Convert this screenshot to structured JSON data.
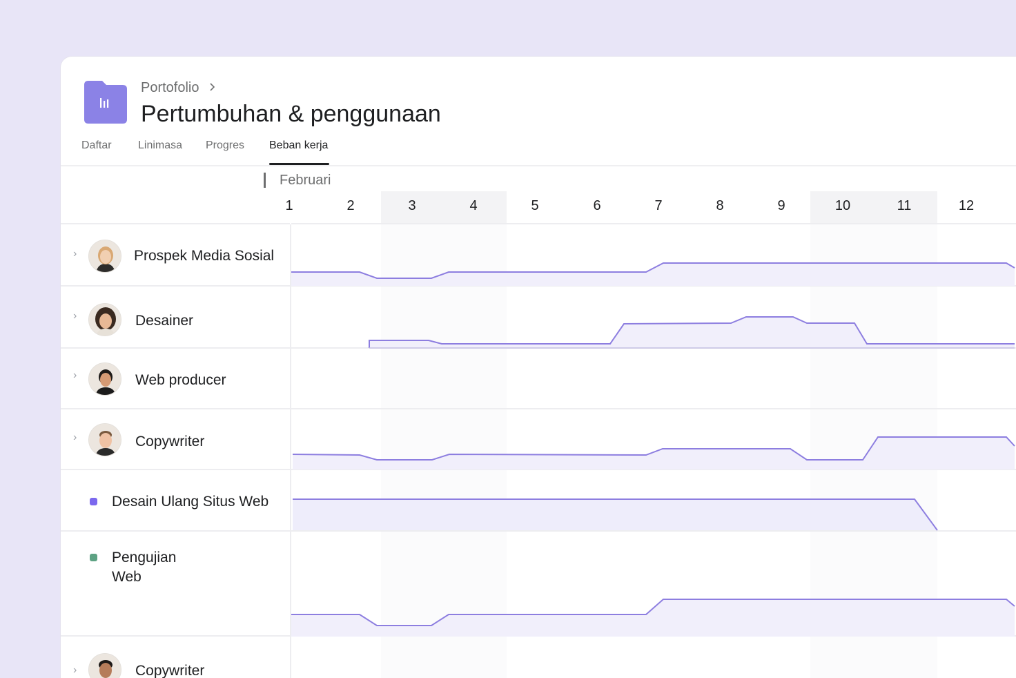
{
  "breadcrumb": {
    "parent": "Portofolio"
  },
  "page": {
    "title": "Pertumbuhan & penggunaan"
  },
  "tabs": [
    {
      "label": "Daftar",
      "active": false
    },
    {
      "label": "Linimasa",
      "active": false
    },
    {
      "label": "Progres",
      "active": false
    },
    {
      "label": "Beban kerja",
      "active": true
    }
  ],
  "calendar": {
    "month": "Februari",
    "days": [
      "1",
      "2",
      "3",
      "4",
      "5",
      "6",
      "7",
      "8",
      "9",
      "10",
      "11",
      "12"
    ]
  },
  "rows": [
    {
      "label": "Prospek Media Sosial",
      "type": "person"
    },
    {
      "label": "Desainer",
      "type": "person"
    },
    {
      "label": "Web producer",
      "type": "person"
    },
    {
      "label": "Copywriter",
      "type": "person"
    },
    {
      "label": "Desain Ulang Situs Web",
      "type": "project",
      "color": "#7b68ee"
    },
    {
      "label_line1": "Pengujian",
      "label_line2": "Web",
      "type": "project",
      "color": "#5da283"
    },
    {
      "label": "Copywriter",
      "type": "person"
    }
  ],
  "colors": {
    "accent": "#8d7ee0",
    "accent_fill": "#f1effb",
    "project_icon": "#8b82e6",
    "background": "#e8e5f7"
  },
  "icons": {
    "project": "bar-chart-icon",
    "breadcrumb_separator": "chevron-right-icon",
    "row_expand": "chevron-right-icon"
  }
}
